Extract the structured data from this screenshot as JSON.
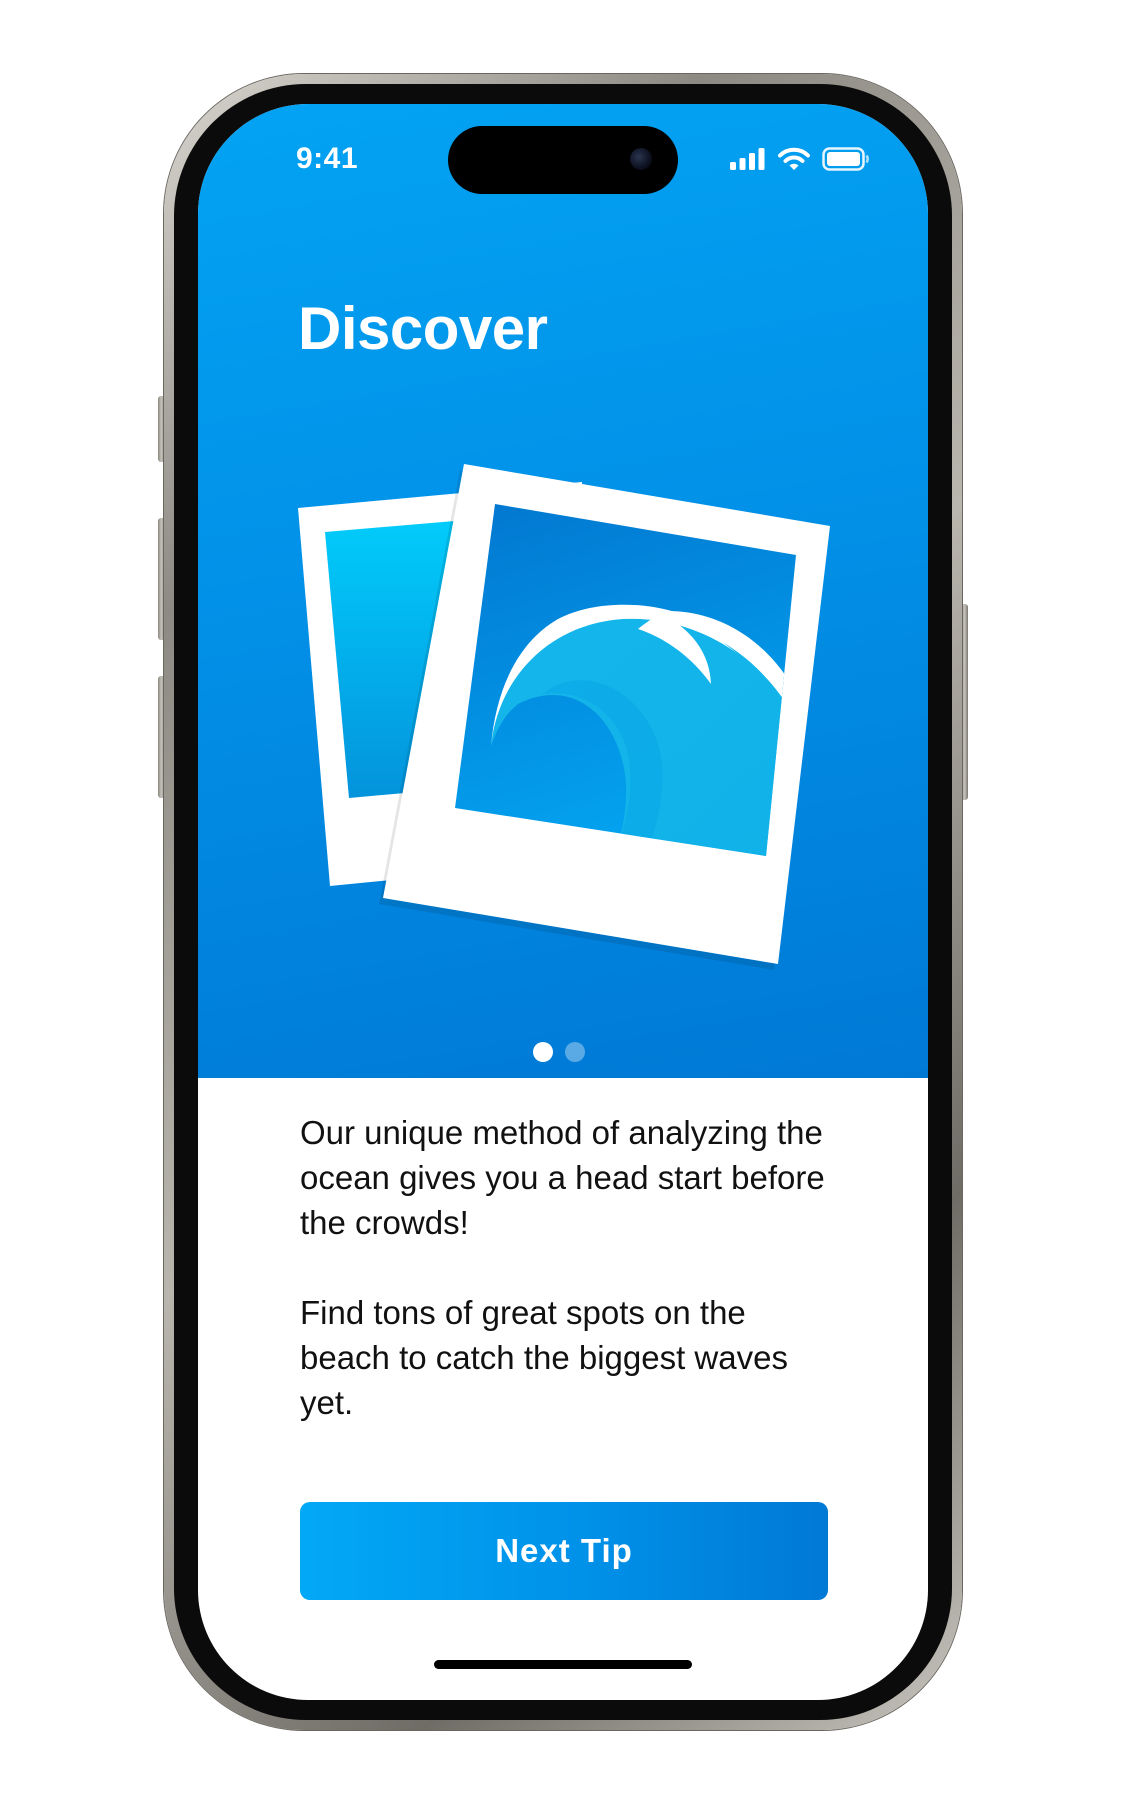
{
  "status_bar": {
    "time": "9:41",
    "icons": [
      "cellular-signal-icon",
      "wifi-icon",
      "battery-icon"
    ]
  },
  "onboarding": {
    "title": "Discover",
    "illustration": "photos-wave-illustration",
    "page_indicator": {
      "total": 2,
      "current": 1
    },
    "paragraph_1": "Our unique method of analyzing the ocean gives you a head start before the crowds!",
    "paragraph_2": "Find tons of great spots on the beach to catch the biggest waves yet.",
    "button_label": "Next Tip"
  },
  "colors": {
    "accent_light": "#02a8f6",
    "accent_dark": "#0079d5",
    "text": "#111111",
    "background": "#ffffff"
  }
}
